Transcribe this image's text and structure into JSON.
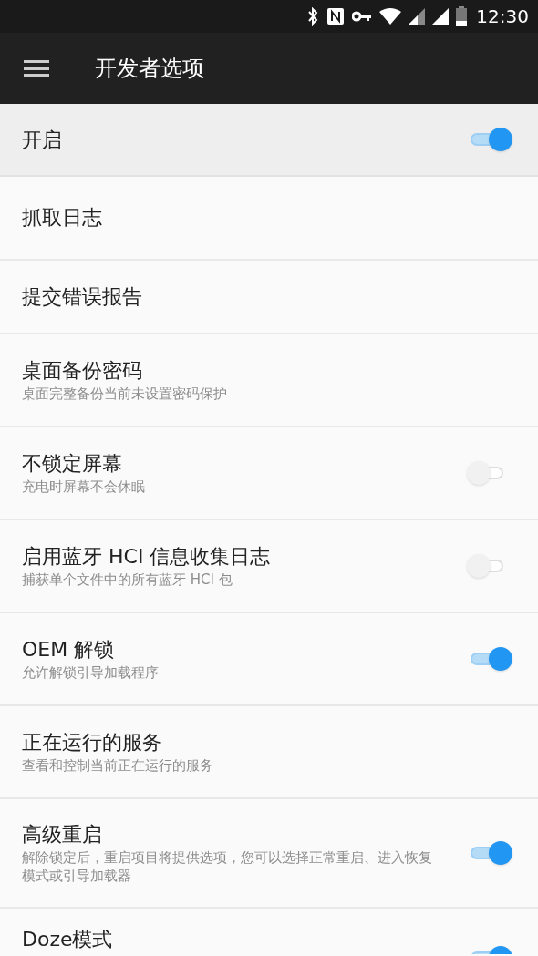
{
  "status_bar": {
    "time": "12:30"
  },
  "app_bar": {
    "title": "开发者选项"
  },
  "master_switch": {
    "label": "开启",
    "on": true
  },
  "items": [
    {
      "kind": "plain",
      "title": "抓取日志"
    },
    {
      "kind": "plain",
      "title": "提交错误报告"
    },
    {
      "kind": "plain",
      "title": "桌面备份密码",
      "subtitle": "桌面完整备份当前未设置密码保护"
    },
    {
      "kind": "toggle",
      "title": "不锁定屏幕",
      "subtitle": "充电时屏幕不会休眠",
      "on": false
    },
    {
      "kind": "toggle",
      "title": "启用蓝牙 HCI 信息收集日志",
      "subtitle": "捕获单个文件中的所有蓝牙 HCI 包",
      "on": false
    },
    {
      "kind": "toggle",
      "title": "OEM 解锁",
      "subtitle": "允许解锁引导加载程序",
      "on": true
    },
    {
      "kind": "plain",
      "title": "正在运行的服务",
      "subtitle": "查看和控制当前正在运行的服务"
    },
    {
      "kind": "toggle",
      "title": "高级重启",
      "subtitle": "解除锁定后，重启项目将提供选项，您可以选择正常重启、进入恢复模式或引导加载器",
      "on": true
    },
    {
      "kind": "toggle",
      "title": "Doze模式",
      "on": true
    }
  ]
}
